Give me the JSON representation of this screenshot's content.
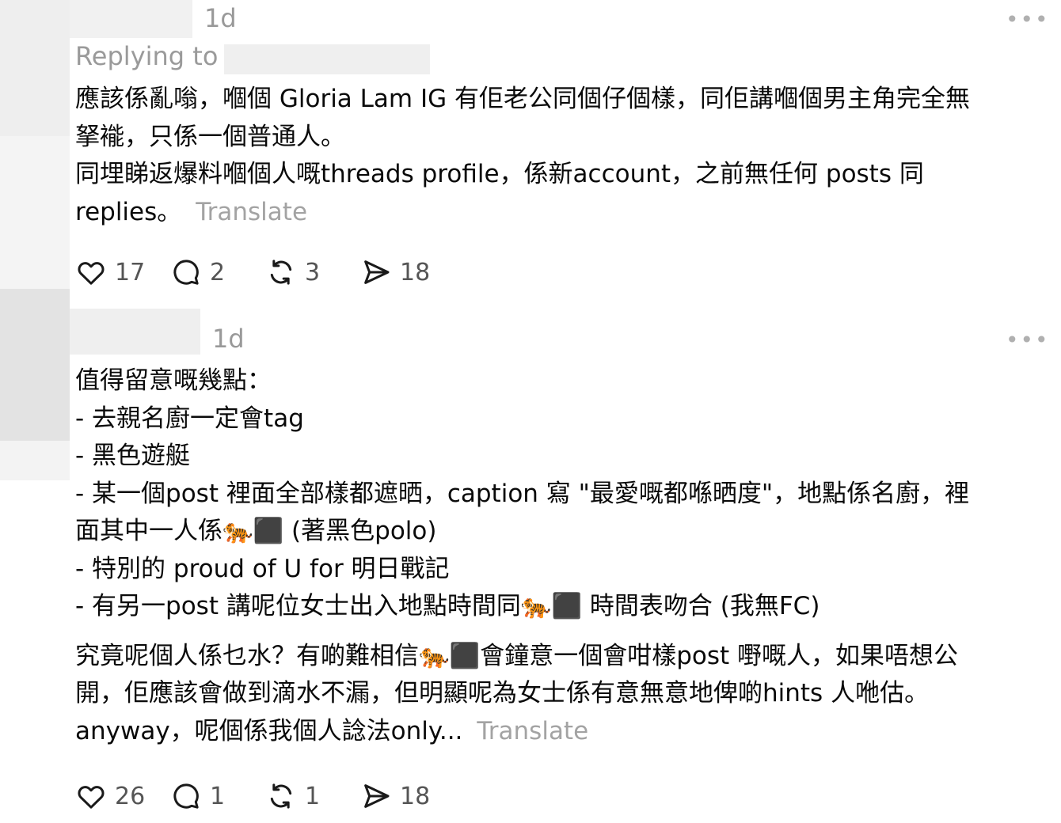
{
  "post1": {
    "time": "1d",
    "more_label": "•••",
    "replying_label": "Replying to",
    "lines": [
      "應該係亂嗡，嗰個 Gloria Lam IG 有佢老公同個仔個樣，同佢講嗰個男主角完全無",
      "拏褦，只係一個普通人。",
      "同埋睇返爆料嗰個人嘅threads profile，係新account，之前無任何 posts 同",
      "replies。"
    ],
    "translate": "Translate",
    "likes": "17",
    "comments": "2",
    "reposts": "3",
    "shares": "18"
  },
  "post2": {
    "time": "1d",
    "more_label": "•••",
    "lines": [
      "值得留意嘅幾點：",
      "- 去親名廚一定會tag",
      "- 黑色遊艇",
      "- 某一個post 裡面全部樣都遮晒，caption 寫 \"最愛嘅都喺晒度\"，地點係名廚，裡",
      "面其中一人係🐅⬛ (著黑色polo)",
      "- 特別的 proud of U for 明日戰記",
      "- 有另一post 講呢位女士出入地點時間同🐅⬛ 時間表吻合 (我無FC)"
    ],
    "lines2": [
      "究竟呢個人係乜水？有啲難相信🐅⬛會鐘意一個會咁樣post 嘢嘅人，如果唔想公",
      "開，佢應該會做到滴水不漏，但明顯呢為女士係有意無意地俾啲hints 人咃估。",
      "anyway，呢個係我個人諗法only..."
    ],
    "translate": "Translate",
    "likes": "26",
    "comments": "1",
    "reposts": "1",
    "shares": "18"
  },
  "icons": {
    "like": "heart-icon",
    "comment": "comment-bubble-icon",
    "repost": "repost-icon",
    "share": "send-icon",
    "more": "more-options-icon"
  }
}
